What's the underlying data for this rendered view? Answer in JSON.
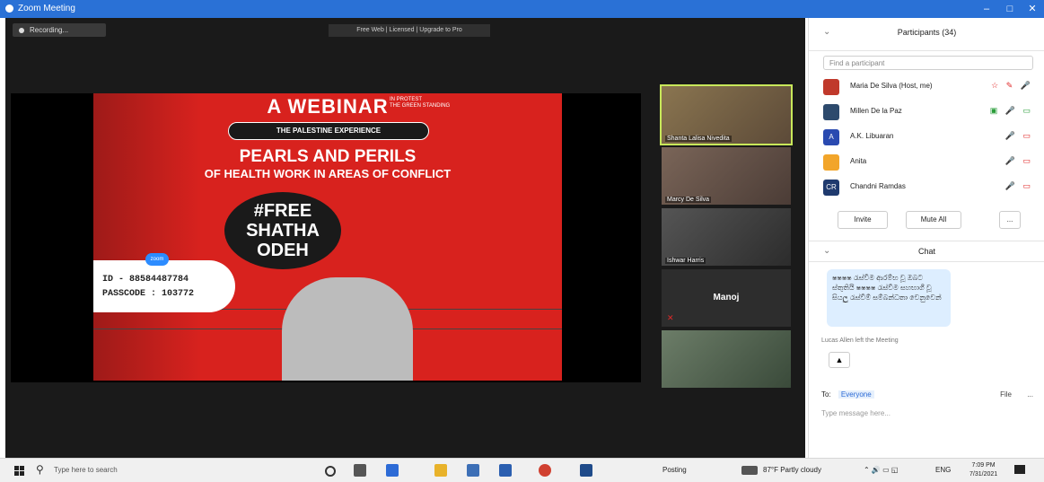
{
  "window": {
    "title": "Zoom Meeting",
    "controls": [
      "–",
      "□",
      "✕"
    ]
  },
  "meeting": {
    "recording_label": "Recording...",
    "notice": "Free Web | Licensed | Upgrade to Pro"
  },
  "poster": {
    "title": "A WEBINAR",
    "title_note": "IN PROTEST\nTHE GREEN STANDING",
    "pill": "THE PALESTINE EXPERIENCE",
    "headline": "PEARLS AND PERILS",
    "subheadline": "OF HEALTH WORK IN AREAS OF CONFLICT",
    "hashtag_lines": [
      "#FREE",
      "SHATHA",
      "ODEH"
    ],
    "zoom_tag": "zoom",
    "meeting_id": "ID - 88584487784",
    "passcode": "PASSCODE : 103772"
  },
  "video_tiles": [
    {
      "name": "Shanta Lalisa Nivedita",
      "bg": "#7c6a45",
      "active": true
    },
    {
      "name": "Marcy De Silva",
      "bg": "#6d5a50",
      "active": false
    },
    {
      "name": "Ishwar Harris",
      "bg": "#3d3d3d",
      "active": false
    },
    {
      "name": "Manoj",
      "bg": "#2d2d2d",
      "active": false,
      "text_only": true
    },
    {
      "name": "",
      "bg": "#5b6d5a",
      "active": false
    }
  ],
  "participants_panel": {
    "title": "Participants (34)",
    "search_placeholder": "Find a participant",
    "participants": [
      {
        "name": "Maria De Silva (Host, me)",
        "avatar_color": "#c0392b",
        "initial": "",
        "icons": "☆ ✎ 🎤"
      },
      {
        "name": "Millen De la Paz",
        "avatar_color": "#2d4a6d",
        "initial": "",
        "icons": "▣ 🎤 ▭"
      },
      {
        "name": "A.K. Libuaran",
        "avatar_color": "#2a4ab0",
        "initial": "A",
        "icons": "🎤 ▭"
      },
      {
        "name": "Anita",
        "avatar_color": "#f2a52a",
        "initial": "",
        "icons": "🎤 ▭"
      },
      {
        "name": "Chandni Ramdas",
        "avatar_color": "#1f3a6e",
        "initial": "CR",
        "icons": "🎤 ▭"
      }
    ],
    "buttons": [
      "Invite",
      "Mute All",
      "..."
    ]
  },
  "chat": {
    "title": "Chat",
    "message": "ෂෂෂෂ රැස්වීම ආරම්භ වූ ඔබට ස්තුතියි ෂෂෂෂ රැස්වීම සහභාගී වූ සියලු රැස්වීම් සම්බන්ධතා වෙනුවෙන්",
    "system_message": "Lucas Allen left the Meeting",
    "to_label": "To:",
    "to_value": "Everyone",
    "file_label": "File",
    "more": "...",
    "input_placeholder": "Type message here..."
  },
  "taskbar": {
    "search_placeholder": "Type here to search",
    "status_text": "Posting",
    "weather": "87°F Partly cloudy",
    "lang": "ENG",
    "time": "7:09 PM",
    "date": "7/31/2021"
  }
}
